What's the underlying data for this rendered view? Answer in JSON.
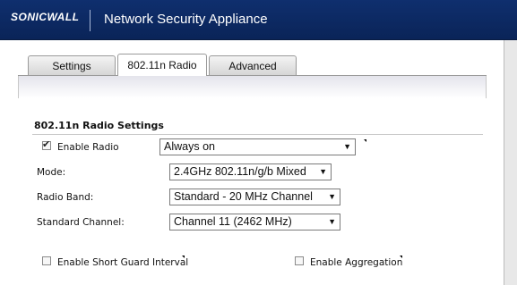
{
  "header": {
    "logo_text": "SONICWALL",
    "title": "Network Security Appliance"
  },
  "tabs": [
    {
      "label": "Settings",
      "active": false
    },
    {
      "label": "802.11n Radio",
      "active": true
    },
    {
      "label": "Advanced",
      "active": false
    }
  ],
  "section": {
    "title": "802.11n Radio Settings"
  },
  "fields": {
    "enable_radio": {
      "label": "Enable Radio",
      "checked": true,
      "value": "Always on"
    },
    "mode": {
      "label": "Mode:",
      "value": "2.4GHz 802.11n/g/b Mixed"
    },
    "radio_band": {
      "label": "Radio Band:",
      "value": "Standard - 20 MHz Channel"
    },
    "standard_channel": {
      "label": "Standard Channel:",
      "value": "Channel 11 (2462 MHz)"
    },
    "short_guard": {
      "label": "Enable Short Guard Interval",
      "checked": false
    },
    "aggregation": {
      "label": "Enable Aggregation",
      "checked": false
    }
  },
  "icons": {
    "dropdown_arrow": "chevron-down-icon",
    "checkmark": "check-icon",
    "help_tick": "tooltip-marker-icon"
  },
  "colors": {
    "header_bg": "#0f2f6e",
    "header_text": "#ffffff"
  }
}
